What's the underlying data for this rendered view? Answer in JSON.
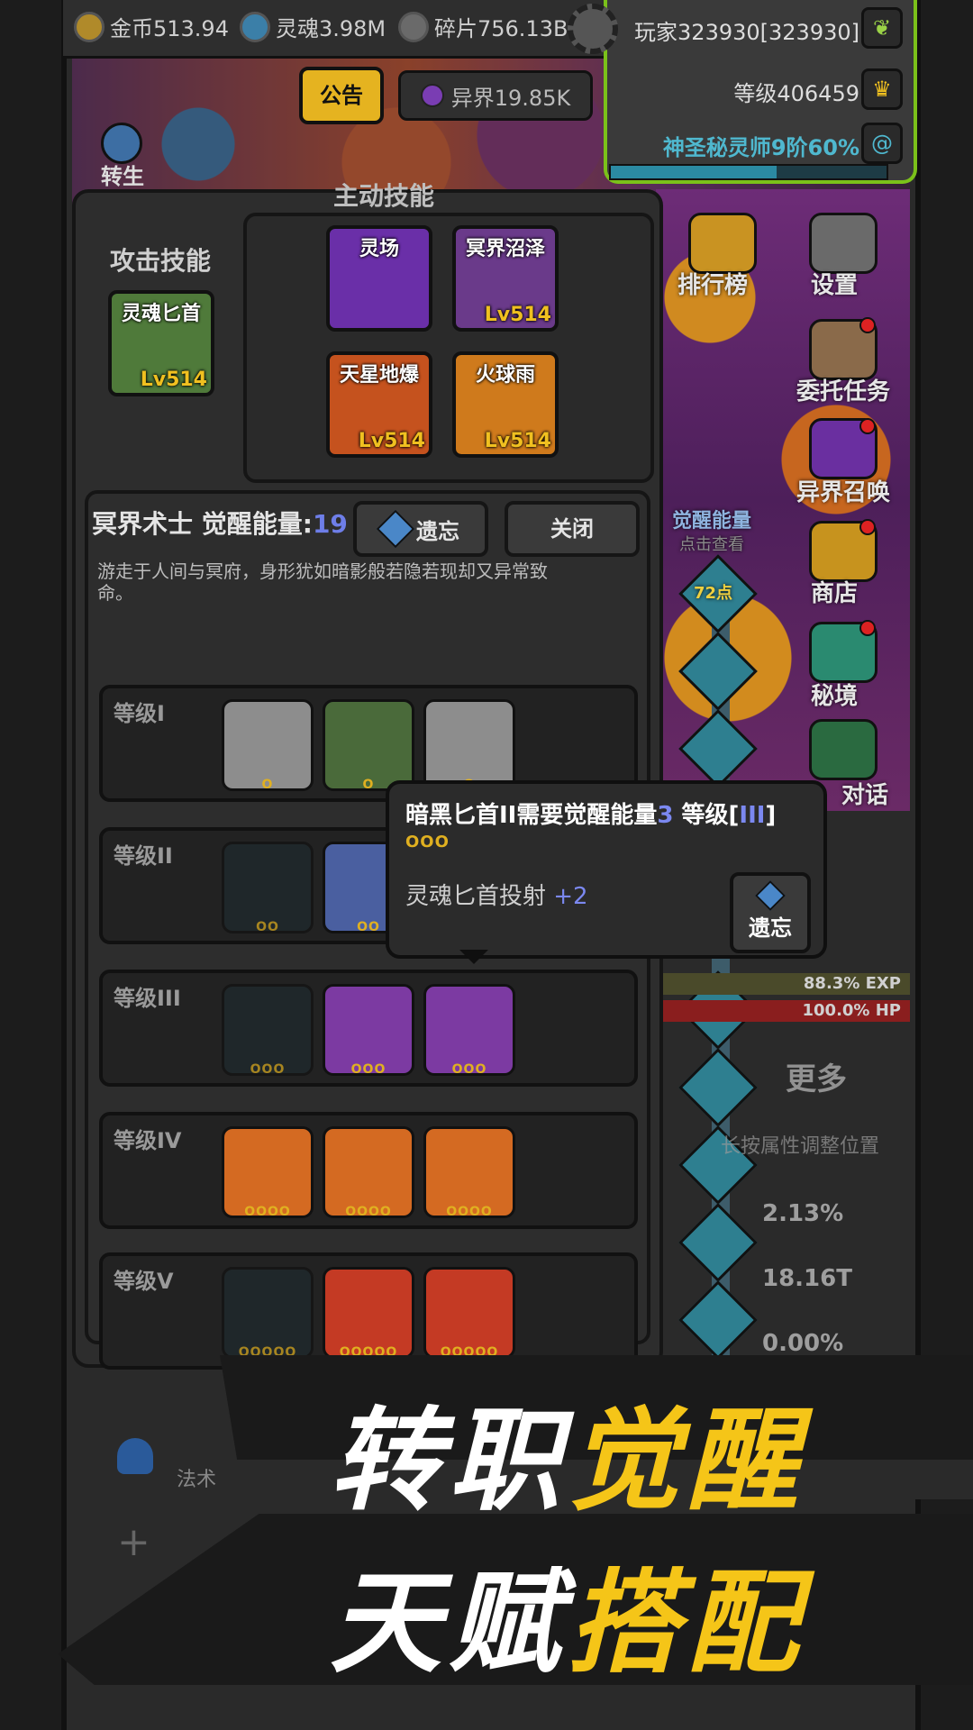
{
  "resources": {
    "gold": "金币513.94",
    "soul": "灵魂3.98M",
    "fragments": "碎片756.13B"
  },
  "player": {
    "name": "玩家323930[323930]",
    "level": "等级406459",
    "class": "神圣秘灵师9阶60%",
    "class_progress": 0.6
  },
  "top_buttons": {
    "notice": "公告",
    "otherworld": "异界19.85K",
    "rebirth": "转生"
  },
  "right_menu": [
    {
      "label": "排行榜"
    },
    {
      "label": "设置"
    },
    {
      "label": "委托任务"
    },
    {
      "label": "异界召唤"
    },
    {
      "label": "商店"
    },
    {
      "label": "秘境"
    },
    {
      "label": "对话"
    }
  ],
  "awaken_column": {
    "title": "觉醒能量",
    "hint": "点击查看",
    "points": "72点"
  },
  "skills_panel": {
    "active_title": "主动技能",
    "attack_title": "攻击技能",
    "attack_skill": {
      "name": "灵魂匕首",
      "level": "Lv514"
    },
    "active_skills": [
      {
        "name": "灵场",
        "level": ""
      },
      {
        "name": "冥界沼泽",
        "level": "Lv514"
      },
      {
        "name": "天星地爆",
        "level": "Lv514"
      },
      {
        "name": "火球雨",
        "level": "Lv514"
      }
    ]
  },
  "class_section": {
    "name": "冥界术士 觉醒能量:",
    "energy": "19",
    "forget_label": "遗忘",
    "close_label": "关闭",
    "description": "游走于人间与冥府，身形犹如暗影般若隐若现却又异常致命。"
  },
  "tiers": [
    {
      "label": "等级I",
      "slots": [
        {
          "pips": "O"
        },
        {
          "pips": "O"
        },
        {
          "pips": "O"
        }
      ]
    },
    {
      "label": "等级II",
      "slots": [
        {
          "pips": "OO"
        },
        {
          "pips": "OO"
        }
      ]
    },
    {
      "label": "等级III",
      "slots": [
        {
          "pips": "OOO"
        },
        {
          "pips": "OOO"
        },
        {
          "pips": "OOO"
        }
      ]
    },
    {
      "label": "等级IV",
      "slots": [
        {
          "pips": "OOOO"
        },
        {
          "pips": "OOOO"
        },
        {
          "pips": "OOOO"
        }
      ]
    },
    {
      "label": "等级V",
      "slots": [
        {
          "pips": "OOOOO"
        },
        {
          "pips": "OOOOO"
        },
        {
          "pips": "OOOOO"
        }
      ]
    }
  ],
  "tooltip": {
    "title_a": "暗黑匕首II需要觉醒能量",
    "title_cost": "3",
    "title_b": " 等级[",
    "title_tier": "III",
    "title_c": "]",
    "pips": "OOO",
    "effect": "灵魂匕首投射 ",
    "effect_value": "+2",
    "forget_label": "遗忘"
  },
  "status": {
    "exp": "88.3% EXP",
    "hp": "100.0%  HP",
    "more": "更多",
    "adjust": "长按属性调整位置",
    "stats": [
      "2.13%",
      "18.16T",
      "0.00%"
    ]
  },
  "left_bottom": {
    "magic": "法术"
  },
  "banner": {
    "line1_white": "转职",
    "line1_yellow": "觉醒",
    "line2_white": "天赋",
    "line2_yellow": "搭配"
  },
  "colors": {
    "accent_green": "#7bc11a",
    "gold": "#f5c518",
    "energy_blue": "#7b88f0"
  }
}
